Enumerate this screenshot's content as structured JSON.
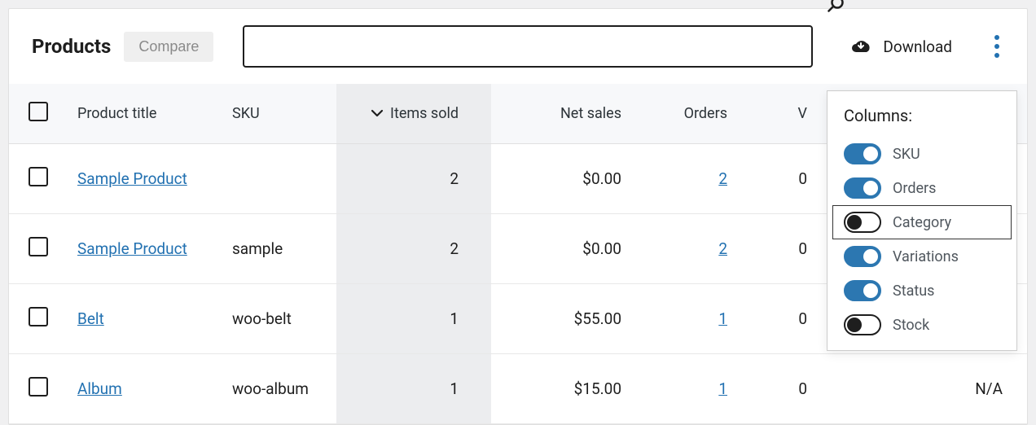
{
  "header": {
    "title": "Products",
    "compare_label": "Compare",
    "download_label": "Download",
    "search_value": ""
  },
  "columns": {
    "title": "Product title",
    "sku": "SKU",
    "items_sold": "Items sold",
    "net_sales": "Net sales",
    "orders": "Orders",
    "truncated": "V"
  },
  "rows": [
    {
      "title": "Sample Product",
      "sku": "",
      "items": "2",
      "net": "$0.00",
      "orders": "2",
      "v": "0",
      "rest": ""
    },
    {
      "title": "Sample Product",
      "sku": "sample",
      "items": "2",
      "net": "$0.00",
      "orders": "2",
      "v": "0",
      "rest": ""
    },
    {
      "title": "Belt",
      "sku": "woo-belt",
      "items": "1",
      "net": "$55.00",
      "orders": "1",
      "v": "0",
      "rest": ""
    },
    {
      "title": "Album",
      "sku": "woo-album",
      "items": "1",
      "net": "$15.00",
      "orders": "1",
      "v": "0",
      "rest": "N/A"
    }
  ],
  "popover": {
    "title": "Columns:",
    "items": [
      {
        "label": "SKU",
        "on": true,
        "focused": false
      },
      {
        "label": "Orders",
        "on": true,
        "focused": false
      },
      {
        "label": "Category",
        "on": false,
        "focused": true
      },
      {
        "label": "Variations",
        "on": true,
        "focused": false
      },
      {
        "label": "Status",
        "on": true,
        "focused": false
      },
      {
        "label": "Stock",
        "on": false,
        "focused": false
      }
    ]
  }
}
